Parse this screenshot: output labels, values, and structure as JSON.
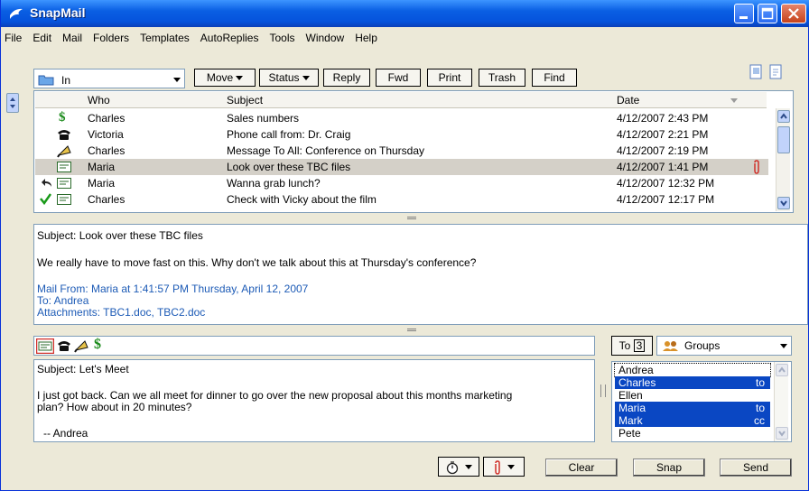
{
  "window": {
    "title": "SnapMail"
  },
  "menu": [
    "File",
    "Edit",
    "Mail",
    "Folders",
    "Templates",
    "AutoReplies",
    "Tools",
    "Window",
    "Help"
  ],
  "toolbar": {
    "folder": "In",
    "move": "Move",
    "status": "Status",
    "reply": "Reply",
    "fwd": "Fwd",
    "print": "Print",
    "trash": "Trash",
    "find": "Find"
  },
  "columns": {
    "who": "Who",
    "subject": "Subject",
    "date": "Date"
  },
  "messages": [
    {
      "icon": "dollar-icon",
      "who": "Charles",
      "subject": "Sales numbers",
      "date": "4/12/2007 2:43 PM"
    },
    {
      "icon": "phone-icon",
      "who": "Victoria",
      "subject": "Phone call from: Dr. Craig",
      "date": "4/12/2007 2:21 PM"
    },
    {
      "icon": "megaphone-icon",
      "who": "Charles",
      "subject": "Message To All: Conference on Thursday",
      "date": "4/12/2007 2:19 PM"
    },
    {
      "icon": "mail-icon",
      "who": "Maria",
      "subject": "Look over these TBC files",
      "date": "4/12/2007 1:41 PM",
      "attachment": true
    },
    {
      "icon": "mail-icon",
      "who": "Maria",
      "subject": "Wanna grab lunch?",
      "date": "4/12/2007 12:32 PM",
      "replied": true
    },
    {
      "icon": "mail-icon",
      "who": "Charles",
      "subject": "Check with Vicky about the film",
      "date": "4/12/2007 12:17 PM",
      "done": true
    }
  ],
  "preview": {
    "subject": "Subject: Look over these TBC files",
    "body": "We really have to move fast on this.  Why don't we talk about this at Thursday's conference?",
    "from": "Mail From: Maria at 1:41:57 PM Thursday, April 12, 2007",
    "to": "To: Andrea",
    "attachments": "Attachments:  TBC1.doc, TBC2.doc"
  },
  "compose": {
    "to_label": "To",
    "to_count": "3",
    "groups_label": "Groups",
    "subject": "Subject: Let's Meet",
    "body_line1": "I just got back. Can we all meet for dinner to go over the new proposal about this months marketing",
    "body_line2": "plan? How about in 20 minutes?",
    "signature": "-- Andrea"
  },
  "recipients": [
    {
      "name": "Andrea",
      "role": "",
      "selected": false
    },
    {
      "name": "Charles",
      "role": "to",
      "selected": true
    },
    {
      "name": "Ellen",
      "role": "",
      "selected": false
    },
    {
      "name": "Maria",
      "role": "to",
      "selected": true
    },
    {
      "name": "Mark",
      "role": "cc",
      "selected": true
    },
    {
      "name": "Pete",
      "role": "",
      "selected": false
    }
  ],
  "footer": {
    "clear": "Clear",
    "snap": "Snap",
    "send": "Send"
  },
  "colors": {
    "titlebar": "#0553dc",
    "selection": "#0a47c3",
    "link_text": "#1d5bb6",
    "dollar": "#1a8a1a"
  }
}
